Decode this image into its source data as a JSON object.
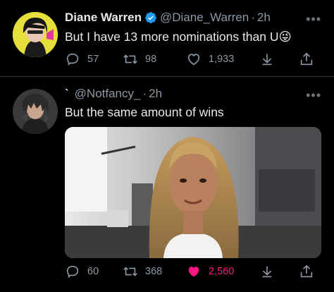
{
  "tweet1": {
    "name": "Diane Warren",
    "handle": "@Diane_Warren",
    "time": "2h",
    "text": "But I have 13 more nominations than U",
    "emoji": "😜",
    "replies": "57",
    "retweets": "98",
    "likes": "1,933"
  },
  "tweet2": {
    "name": "`",
    "handle": "@Notfancy_",
    "time": "2h",
    "text": "But the same amount of wins",
    "replies": "60",
    "retweets": "368",
    "likes": "2,560"
  },
  "more_label": "•••",
  "colors": {
    "like_active": "#f91880",
    "verified": "#1d9bf0",
    "muted": "#8b98a5"
  }
}
